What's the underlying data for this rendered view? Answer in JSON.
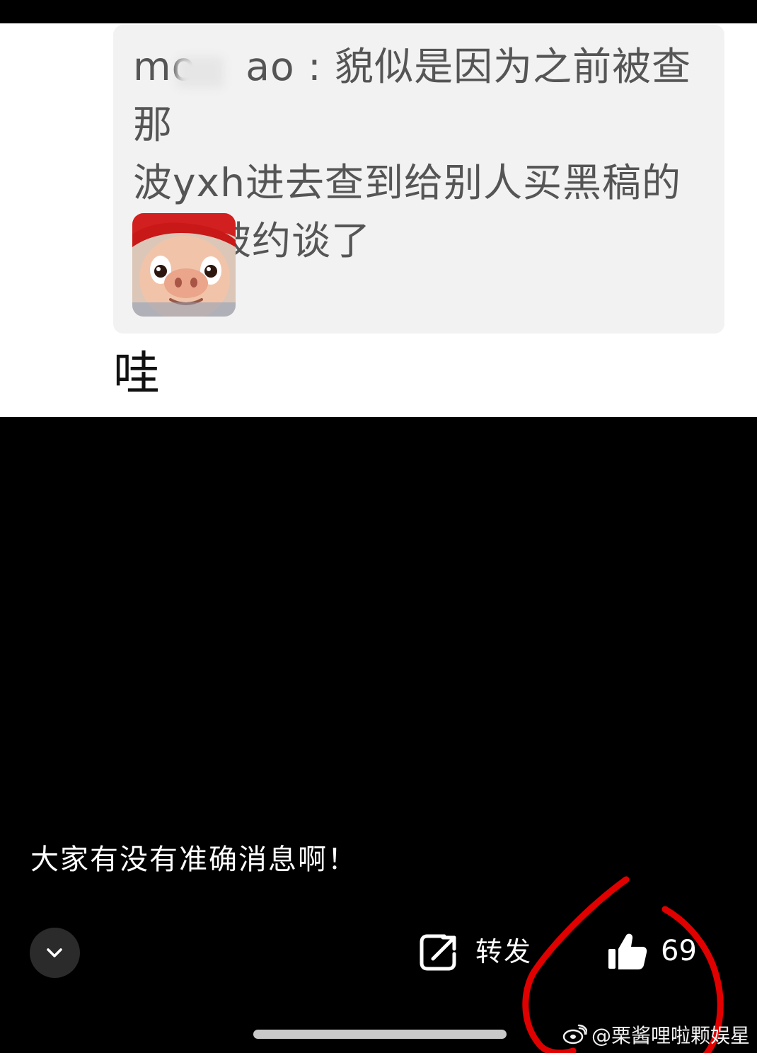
{
  "post": {
    "quote_username_visible": "mo",
    "quote_username_suffix": "ao",
    "quote_line_1_rest": ": 貌似是因为之前被查那",
    "quote_line_2": "波yxh进去查到给别人买黑稿的",
    "quote_line_3": "团队被约谈了",
    "sticker_icon": "pig-face-sticker-icon",
    "reply_text": "哇"
  },
  "footer": {
    "caption": "大家有没有准确消息啊！",
    "collapse_icon": "chevron-down-icon",
    "share_icon": "share-icon",
    "share_label": "转发",
    "like_icon": "thumbs-up-icon",
    "like_count": "69"
  },
  "watermark": {
    "icon": "weibo-logo-icon",
    "text": "@栗酱哩啦颗娱星"
  },
  "colors": {
    "annotation_red": "#e00000",
    "quote_bg": "#f2f2f2",
    "quote_text": "#555555"
  }
}
